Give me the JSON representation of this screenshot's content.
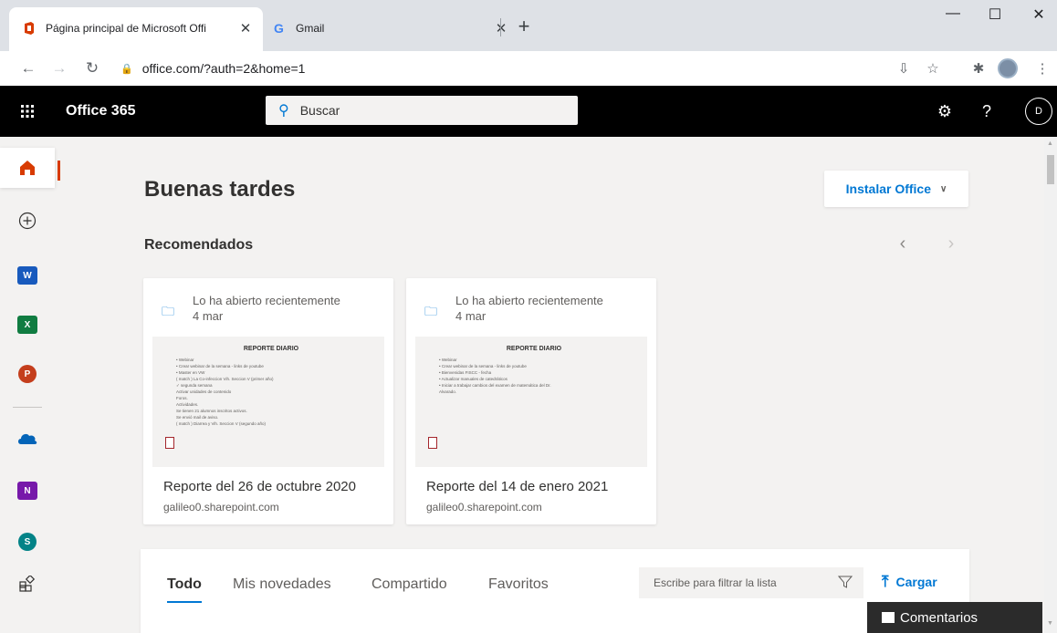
{
  "browser": {
    "tabs": [
      {
        "title": "Página principal de Microsoft Offi",
        "close": "✕"
      },
      {
        "title": "Gmail",
        "close": "✕"
      }
    ],
    "new_tab": "+",
    "window_controls": {
      "minimize": "—",
      "maximize": "☐",
      "close": "✕"
    },
    "url": "office.com/?auth=2&home=1"
  },
  "office": {
    "app_title": "Office 365",
    "search_placeholder": "Buscar",
    "user_initial": "D",
    "help": "?"
  },
  "rail": {
    "apps": [
      "Inicio",
      "Crear",
      "Word",
      "Excel",
      "PowerPoint",
      "OneDrive",
      "OneNote",
      "SharePoint",
      "Todas las aplicaciones"
    ],
    "tile_letters": {
      "word": "W",
      "excel": "X",
      "powerpoint": "P",
      "onenote": "N",
      "sharepoint": "S"
    },
    "colors": {
      "home": "#d83b01",
      "word": "#185abd",
      "excel": "#107c41",
      "powerpoint": "#c43e1c",
      "onedrive": "#0364b8",
      "onenote": "#7719aa",
      "sharepoint": "#038387"
    }
  },
  "main": {
    "greeting": "Buenas tardes",
    "install_office": "Instalar Office",
    "recommended_title": "Recomendados",
    "cards": [
      {
        "activity": "Lo ha abierto recientemente",
        "date": "4 mar",
        "title": "Reporte del 26 de octubre 2020",
        "site": "galileo0.sharepoint.com",
        "thumb_heading": "REPORTE DIARIO",
        "thumb_lines": [
          "•  Webinar",
          "        •  Crear webinar de la semana - links de youtube",
          "•  Master en VW",
          "   ( match ) La Co-infeccion Vih. Seccion V (primer año)",
          "       ✓ segunda semana",
          "         Activar unidades de contenido",
          "         Foros.",
          "         Actividades.",
          "         Se tienen 21 alumnos inscritos activos.",
          "         Se envió mail de aviso.",
          "   ( match ) Diarrea y Vih. Seccion V (segundo año)"
        ]
      },
      {
        "activity": "Lo ha abierto recientemente",
        "date": "4 mar",
        "title": "Reporte del 14 de enero 2021",
        "site": "galileo0.sharepoint.com",
        "thumb_heading": "REPORTE DIARIO",
        "thumb_lines": [
          "•  Webinar",
          "        •  Crear webinar de la semana - links de youtube",
          "        •  Bienvenidas FISCC - fecha",
          "",
          "•  Actualizar manuales de catedráticos",
          "",
          "•  Iniciar a trabajar cambios del examen de matemática del Dr.",
          "    Alvarado."
        ]
      }
    ]
  },
  "files_panel": {
    "tabs": [
      "Todo",
      "Mis novedades",
      "Compartido",
      "Favoritos"
    ],
    "filter_placeholder": "Escribe para filtrar la lista",
    "upload": "Cargar"
  },
  "feedback": "Comentarios"
}
